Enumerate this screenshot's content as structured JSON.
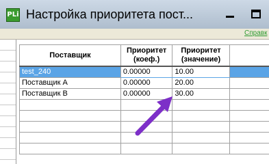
{
  "window": {
    "title": "Настройка приоритета пост...",
    "app_icon": "PLi",
    "help_link": "Справк"
  },
  "grid": {
    "columns": [
      "Поставщик",
      "Приоритет\n(коеф.)",
      "Приоритет\n(значение)"
    ],
    "rows": [
      {
        "supplier": "test_240",
        "priority": "0.00000",
        "value": "10.00",
        "selected": true
      },
      {
        "supplier": "Поставщик А",
        "priority": "0.00000",
        "value": "20.00",
        "selected": false
      },
      {
        "supplier": "Поставщик В",
        "priority": "0.00000",
        "value": "30.00",
        "selected": false
      }
    ],
    "empty_rows": 5
  },
  "annotation": {
    "arrow_color": "#7d2fc8",
    "icon": "arrow-annotation-icon"
  },
  "colors": {
    "selection": "#5aa4e6",
    "help_link": "#2e9b32"
  }
}
